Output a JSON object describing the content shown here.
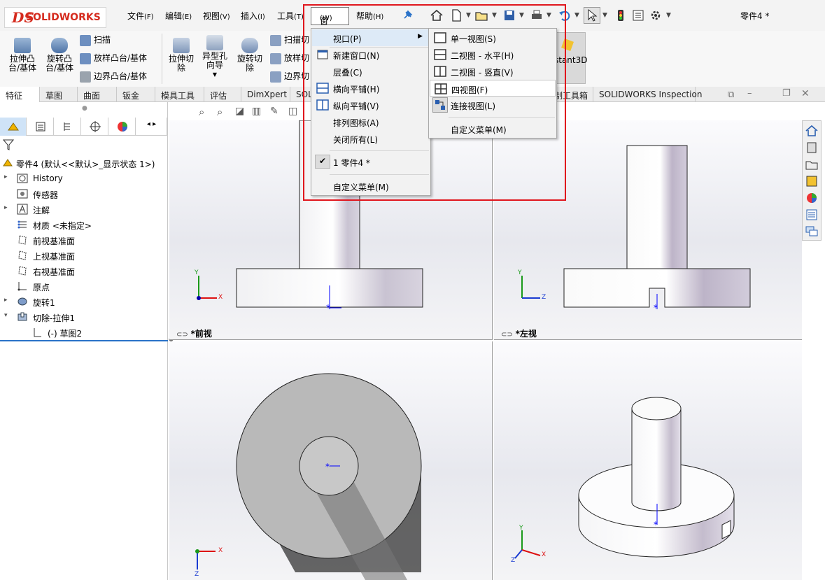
{
  "app": {
    "brand_ds": "DS",
    "brand_name": "SOLIDWORKS",
    "document_title": "零件4 *"
  },
  "menubar": [
    {
      "label": "文件",
      "key": "(F)"
    },
    {
      "label": "编辑",
      "key": "(E)"
    },
    {
      "label": "视图",
      "key": "(V)"
    },
    {
      "label": "插入",
      "key": "(I)"
    },
    {
      "label": "工具",
      "key": "(T)"
    },
    {
      "label": "窗口",
      "key": "(W)"
    },
    {
      "label": "帮助",
      "key": "(H)"
    }
  ],
  "ribbon": {
    "extrude_boss": "拉伸凸\n台/基体",
    "revolve_boss": "旋转凸\n台/基体",
    "sweep": "扫描",
    "loft_boss": "放样凸台/基体",
    "boundary_boss": "边界凸台/基体",
    "extrude_cut": "拉伸切\n除",
    "hole_wizard": "异型孔\n向导",
    "revolve_cut": "旋转切\n除",
    "sweep_cut": "扫描切",
    "loft_cut": "放样切",
    "boundary_cut": "边界切",
    "instant3d": "stant3D"
  },
  "command_tabs": [
    "特征",
    "草图",
    "曲面",
    "钣金",
    "模具工具",
    "评估",
    "DimXpert",
    "SOLI",
    "制工具箱",
    "SOLIDWORKS Inspection"
  ],
  "tree": {
    "root": "零件4  (默认<<默认>_显示状态 1>)",
    "items": [
      "History",
      "传感器",
      "注解",
      "材质 <未指定>",
      "前视基准面",
      "上视基准面",
      "右视基准面",
      "原点",
      "旋转1",
      "切除-拉伸1",
      "(-) 草图2"
    ]
  },
  "viewports": {
    "front_label": "*前视",
    "left_label": "*左视"
  },
  "axes": {
    "x": "X",
    "y": "Y",
    "z": "Z"
  },
  "window_menu": {
    "items": [
      "视口(P)",
      "新建窗口(N)",
      "层叠(C)",
      "横向平铺(H)",
      "纵向平铺(V)",
      "排列图标(A)",
      "关闭所有(L)",
      "1 零件4 *",
      "自定义菜单(M)"
    ]
  },
  "viewport_submenu": {
    "items": [
      "单一视图(S)",
      "二视图 - 水平(H)",
      "二视图 - 竖直(V)",
      "四视图(F)",
      "连接视图(L)",
      "自定义菜单(M)"
    ],
    "highlighted": "四视图(F)"
  },
  "colors": {
    "highlight_box": "#e0161d",
    "brand": "#d52b1e",
    "menu_hover": "#ddeaf7"
  }
}
